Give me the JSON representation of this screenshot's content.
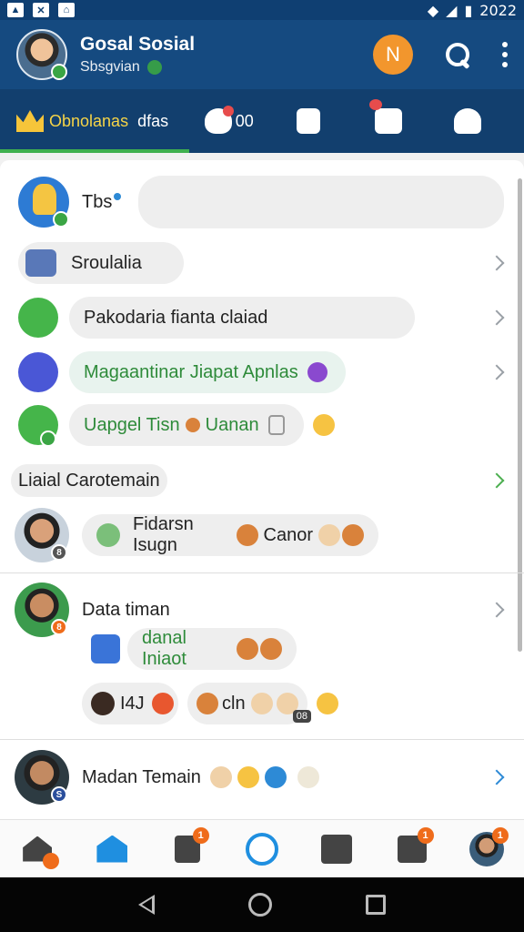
{
  "status_bar": {
    "time": "2022"
  },
  "header": {
    "app_title": "Gosal Sosial",
    "subtitle": "Sbsgvian",
    "avatar_letter": "N"
  },
  "tabs": [
    {
      "label": "Obnolanas",
      "extra": "dfas"
    },
    {
      "label": "00"
    },
    {
      "label": ""
    },
    {
      "label": ""
    },
    {
      "label": ""
    }
  ],
  "composer": {
    "name": "Tbs",
    "placeholder": ""
  },
  "shortcuts": [
    {
      "label": "Sroulalia"
    },
    {
      "label": "Pakodaria fianta claiad"
    },
    {
      "label": "Magaantinar Jiapat Apnlas"
    },
    {
      "label": "Uapgel Tisn",
      "label2": "Uanan"
    }
  ],
  "section": {
    "title": "Liaial Carotemain"
  },
  "posts": [
    {
      "text": "Fidarsn Isugn",
      "text2": "Canor",
      "badge": "8"
    },
    {
      "name": "Data timan",
      "reply1": "danal Iniaot",
      "reply2_a": "I4J",
      "reply2_b": "cln",
      "badge": "8",
      "count": "08"
    },
    {
      "name": "Madan Temain",
      "badge": "S"
    }
  ],
  "nav": {
    "badges": [
      "1",
      "1",
      "1",
      "1"
    ]
  },
  "colors": {
    "header": "#154a80",
    "tabbar": "#123f6e",
    "accent_orange": "#f2962d",
    "active_tab": "#f6d447",
    "green": "#3fb04f"
  }
}
